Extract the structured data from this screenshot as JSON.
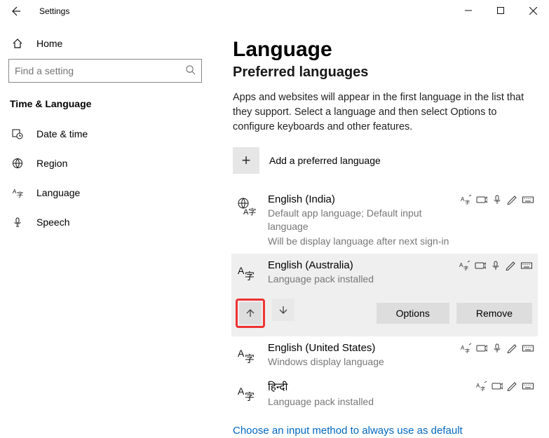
{
  "window": {
    "title": "Settings"
  },
  "home_label": "Home",
  "search_placeholder": "Find a setting",
  "section_header": "Time & Language",
  "nav": {
    "date": "Date & time",
    "region": "Region",
    "language": "Language",
    "speech": "Speech"
  },
  "page": {
    "title": "Language",
    "subheader": "Preferred languages",
    "desc": "Apps and websites will appear in the first language in the list that they support. Select a language and then select Options to configure keyboards and other features.",
    "add_label": "Add a preferred language"
  },
  "langs": {
    "0": {
      "name": "English (India)",
      "sub1": "Default app language; Default input language",
      "sub2": "Will be display language after next sign-in"
    },
    "1": {
      "name": "English (Australia)",
      "sub": "Language pack installed"
    },
    "2": {
      "name": "English (United States)",
      "sub": "Windows display language"
    },
    "3": {
      "name": "हिन्दी",
      "sub": "Language pack installed"
    }
  },
  "actions": {
    "options": "Options",
    "remove": "Remove"
  },
  "link": "Choose an input method to always use as default"
}
